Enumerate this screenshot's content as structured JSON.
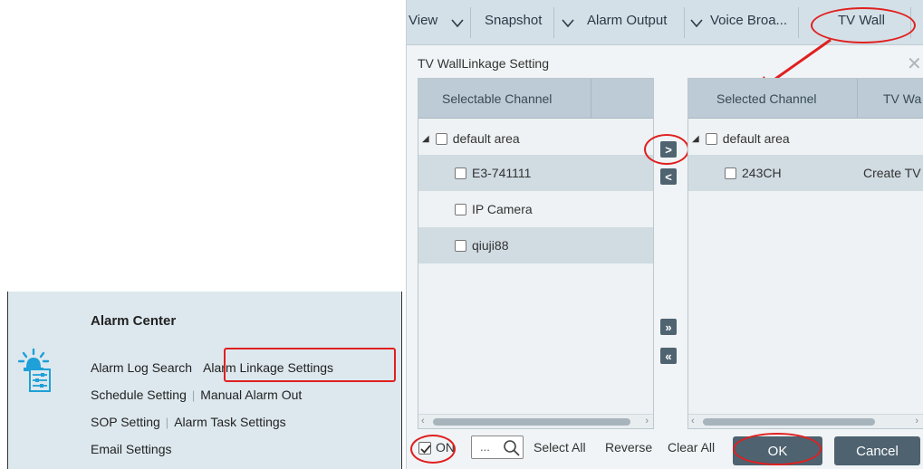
{
  "alarm_center": {
    "title": "Alarm Center",
    "row1": [
      "Alarm Log Search",
      "Alarm Linkage Settings"
    ],
    "row2": [
      "Schedule Setting",
      "Manual Alarm Out"
    ],
    "row3": [
      "SOP Setting",
      "Alarm Task Settings"
    ],
    "row4": [
      "Email Settings"
    ],
    "icon": "alarm-settings-icon"
  },
  "toolbar": {
    "view": "View",
    "snapshot": "Snapshot",
    "alarm_output": "Alarm Output",
    "voice_broadcast": "Voice Broa...",
    "tv_wall": "TV Wall"
  },
  "dialog": {
    "title": "TV WallLinkage Setting",
    "close_icon": "close-icon"
  },
  "left_panel": {
    "header": "Selectable Channel",
    "area": "default area",
    "channels": [
      "E3-741111",
      "IP Camera",
      "qiuji88"
    ]
  },
  "right_panel": {
    "header_selected": "Selected Channel",
    "header_tvwall": "TV Wa",
    "area": "default area",
    "channel": "243CH",
    "channel_action": "Create TV"
  },
  "move_buttons": {
    "add": ">",
    "remove": "<",
    "add_all": "»",
    "remove_all": "«"
  },
  "footer": {
    "on_label": "ON",
    "on_checked": true,
    "search_placeholder": "...",
    "select_all": "Select All",
    "reverse": "Reverse",
    "clear_all": "Clear All",
    "ok": "OK",
    "cancel": "Cancel"
  },
  "colors": {
    "highlight": "#e02020",
    "button": "#4e6270",
    "header": "#bccbd5",
    "alt_row": "#d0dbe2"
  }
}
